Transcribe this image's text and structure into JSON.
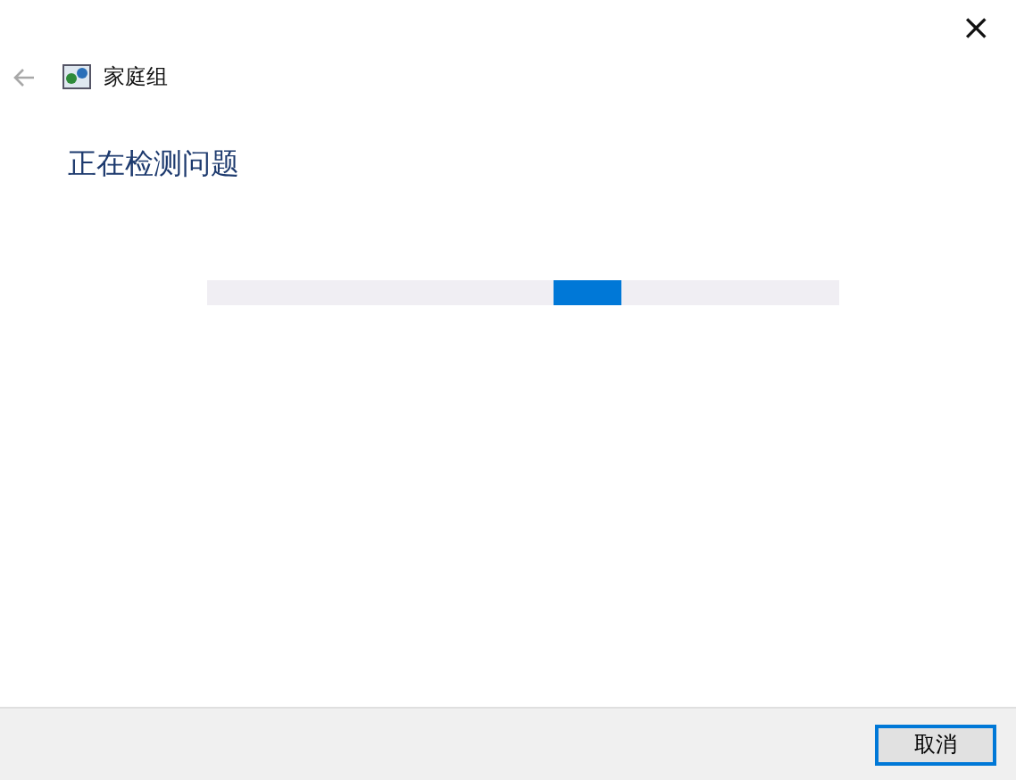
{
  "window": {
    "close_button": "×"
  },
  "nav": {
    "back_disabled": true,
    "title": "家庭组"
  },
  "heading": "正在检测问题",
  "progress": {
    "kind": "marquee"
  },
  "buttons": [
    {
      "label": "取消",
      "focused": true
    }
  ]
}
